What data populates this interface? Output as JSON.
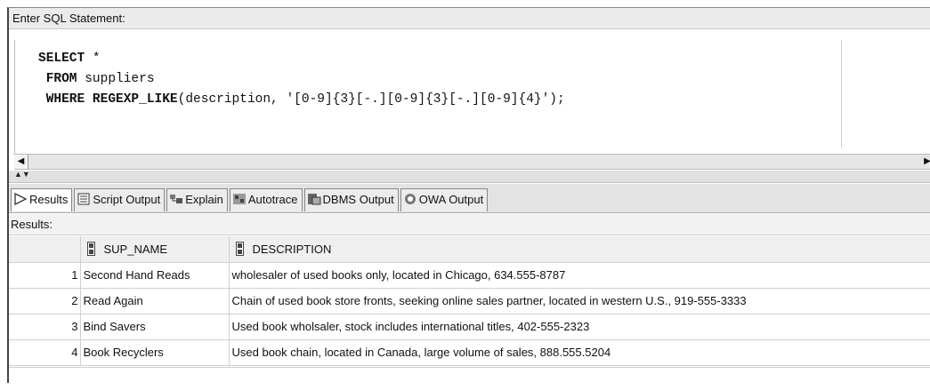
{
  "editor": {
    "header": "Enter SQL Statement:",
    "line1_kw": "SELECT",
    "line1_rest": " *",
    "line2_kw": "FROM",
    "line2_rest": " suppliers",
    "line3_kw": "WHERE REGEXP_LIKE",
    "line3_rest": "(description, '[0-9]{3}[-.][0-9]{3}[-.][0-9]{4}');"
  },
  "tabs": [
    {
      "label": "Results",
      "icon": "play-arrow-icon",
      "active": true
    },
    {
      "label": "Script Output",
      "icon": "script-icon"
    },
    {
      "label": "Explain",
      "icon": "explain-icon"
    },
    {
      "label": "Autotrace",
      "icon": "autotrace-icon"
    },
    {
      "label": "DBMS Output",
      "icon": "dbms-icon"
    },
    {
      "label": "OWA Output",
      "icon": "owa-icon"
    }
  ],
  "results": {
    "label": "Results:",
    "columns": [
      "SUP_NAME",
      "DESCRIPTION"
    ],
    "rows": [
      {
        "num": "1",
        "name": "Second Hand Reads",
        "desc": "wholesaler of used books only, located in Chicago, 634.555-8787"
      },
      {
        "num": "2",
        "name": "Read Again",
        "desc": "Chain of used book store fronts, seeking online sales partner, located in western U.S., 919-555-3333"
      },
      {
        "num": "3",
        "name": "Bind Savers",
        "desc": "Used book wholsaler, stock includes international titles, 402-555-2323"
      },
      {
        "num": "4",
        "name": "Book Recyclers",
        "desc": "Used book chain, located in Canada, large volume of sales, 888.555.5204"
      }
    ]
  },
  "colors": {
    "tab_bg": "#ececec",
    "header_bg": "#ebebeb"
  }
}
